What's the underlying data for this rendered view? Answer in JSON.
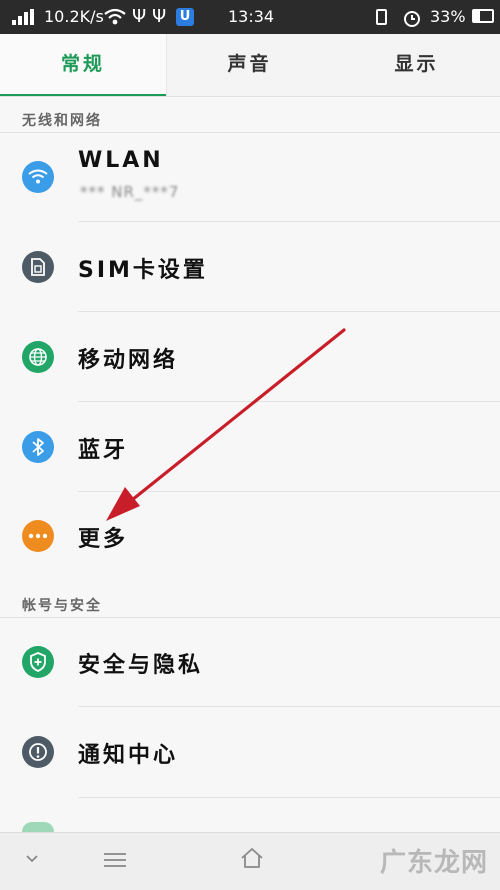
{
  "status_bar": {
    "speed": "10.2K/s",
    "time": "13:34",
    "battery": "33%",
    "icons": [
      "signal-icon",
      "wifi-icon",
      "usb-icon",
      "usb-debug-icon",
      "app-notification-icon",
      "vibrate-icon",
      "alarm-icon",
      "battery-icon"
    ]
  },
  "tabs": [
    {
      "label": "常规",
      "active": true
    },
    {
      "label": "声音",
      "active": false
    },
    {
      "label": "显示",
      "active": false
    }
  ],
  "sections": [
    {
      "header": "无线和网络"
    },
    {
      "header": "帐号与安全"
    }
  ],
  "items": [
    {
      "label": "WLAN",
      "sub": "*** NR_***7",
      "icon": "wifi-icon",
      "color": "#3b9de8"
    },
    {
      "label": "SIM卡设置",
      "icon": "sim-card-icon",
      "color": "#4e5b66"
    },
    {
      "label": "移动网络",
      "icon": "globe-icon",
      "color": "#21a667"
    },
    {
      "label": "蓝牙",
      "icon": "bluetooth-icon",
      "color": "#3b9de8"
    },
    {
      "label": "更多",
      "icon": "more-icon",
      "color": "#ef8c1f"
    },
    {
      "label": "安全与隐私",
      "icon": "shield-icon",
      "color": "#21a667"
    },
    {
      "label": "通知中心",
      "icon": "notice-icon",
      "color": "#4e5b66"
    }
  ],
  "annotation": {
    "arrow_color": "#c81e2a"
  },
  "navbar": {
    "icons": [
      "chevron-down-icon",
      "menu-icon",
      "home-icon"
    ]
  },
  "watermark": "广东龙网"
}
